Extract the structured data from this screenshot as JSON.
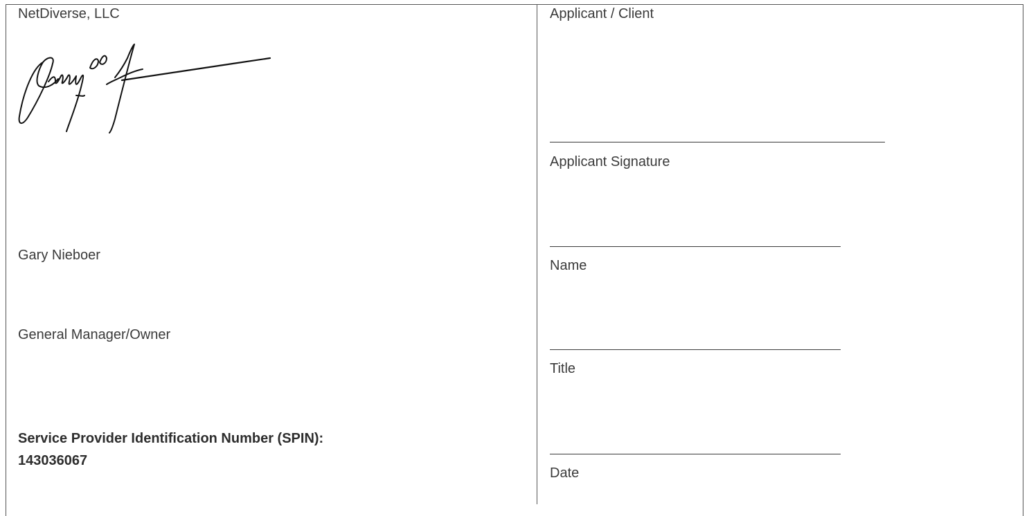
{
  "provider": {
    "company": "NetDiverse, LLC",
    "name": "Gary Nieboer",
    "title": "General Manager/Owner",
    "spin_label": "Service Provider Identification Number (SPIN):",
    "spin_number": "143036067"
  },
  "applicant": {
    "heading": "Applicant / Client",
    "signature_label": "Applicant Signature",
    "name_label": "Name",
    "title_label": "Title",
    "date_label": "Date"
  }
}
